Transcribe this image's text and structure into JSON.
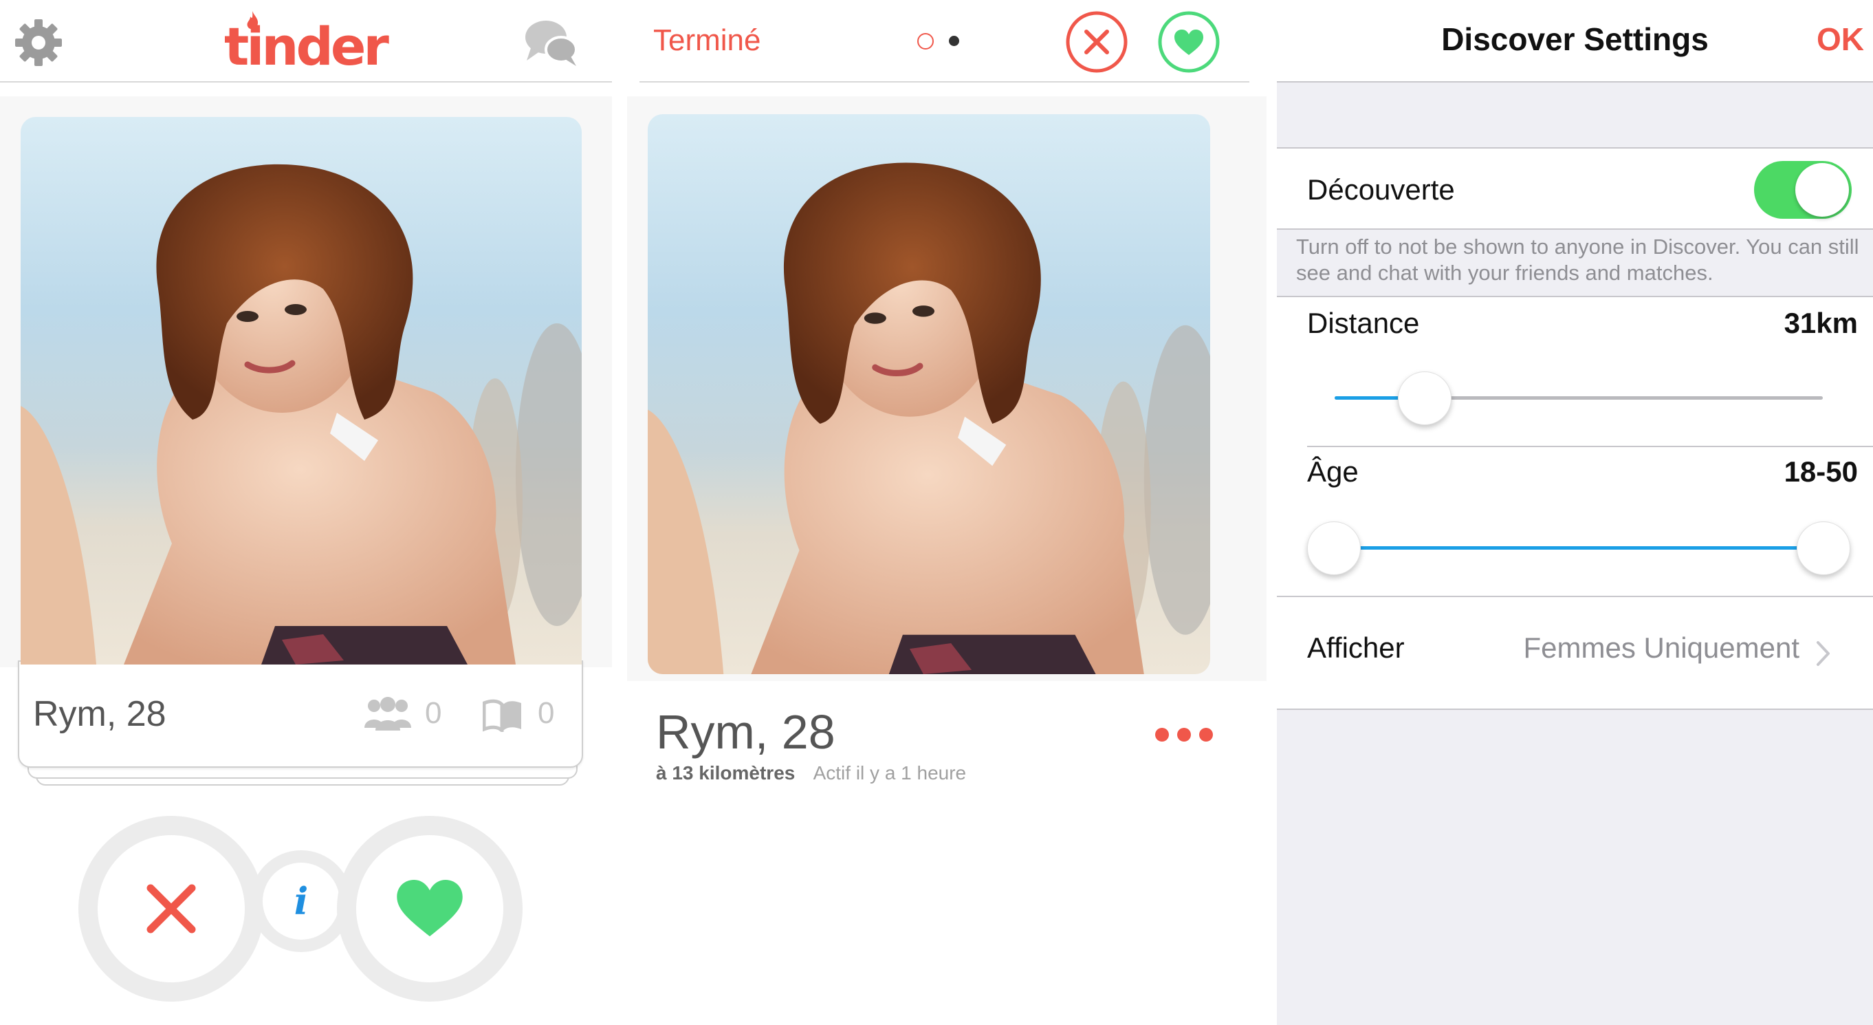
{
  "panel1": {
    "logo": "tinder",
    "card": {
      "name_age": "Rym, 28",
      "shared_friends": "0",
      "shared_interests": "0"
    },
    "icons": [
      "gear-icon",
      "chat-bubbles-icon",
      "friends-icon",
      "book-icon",
      "close-icon",
      "info-icon",
      "heart-icon"
    ],
    "info_label": "i"
  },
  "panel2": {
    "done_label": "Terminé",
    "name_age": "Rym, 28",
    "distance": "à 13 kilomètres",
    "activity": "Actif il y a 1 heure"
  },
  "panel3": {
    "title": "Discover Settings",
    "ok_label": "OK",
    "discovery": {
      "label": "Découverte",
      "enabled": true
    },
    "discovery_footer": "Turn off to not be shown to anyone in Discover. You can still see and chat with your friends and matches.",
    "distance": {
      "label": "Distance",
      "value": "31km",
      "slider_fraction": 0.18
    },
    "age": {
      "label": "Âge",
      "value": "18-50",
      "range_low_fraction": 0.0,
      "range_high_fraction": 1.0
    },
    "show": {
      "label": "Afficher",
      "value": "Femmes Uniquement"
    }
  },
  "colors": {
    "accent": "#f0574a",
    "like": "#4cd97b",
    "slider": "#1a9fe6",
    "toggle_on": "#4cd964"
  }
}
